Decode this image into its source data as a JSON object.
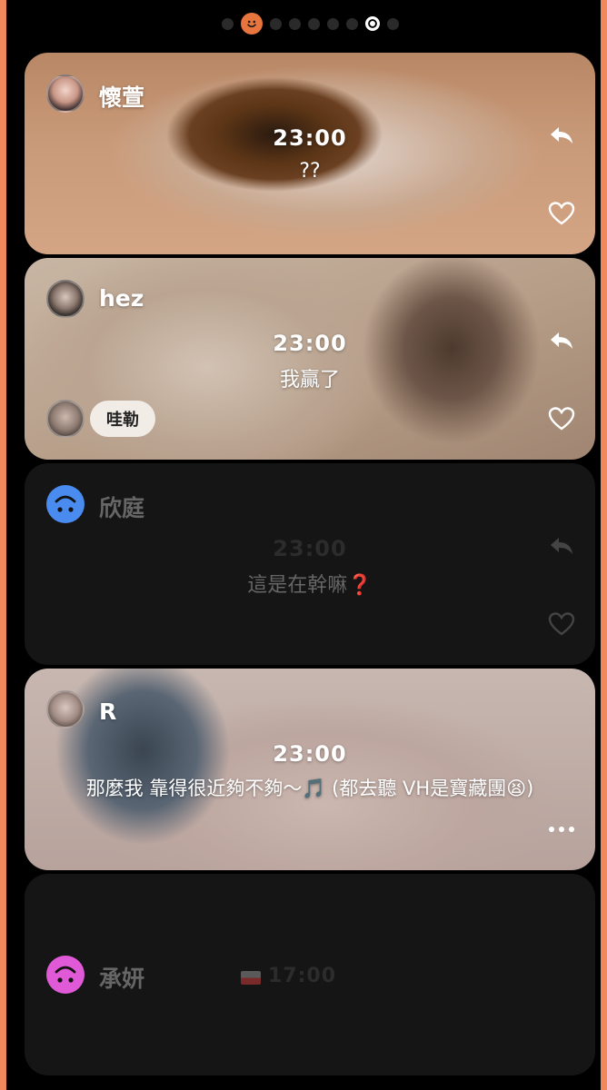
{
  "pagination": {
    "count": 9,
    "active_index": 7
  },
  "accent_color": "#f08a5d",
  "posts": [
    {
      "name": "懷萱",
      "time": "23:00",
      "message": "??"
    },
    {
      "name": "hez",
      "time": "23:00",
      "message": "我贏了",
      "reaction": {
        "label": "哇勒"
      }
    },
    {
      "name": "欣庭",
      "time": "23:00",
      "message": "這是在幹嘛❓"
    },
    {
      "name": "R",
      "time": "23:00",
      "message": "那麼我 靠得很近夠不夠～🎵 (都去聽 VH是寶藏團😫)"
    },
    {
      "name": "承妍",
      "time": "17:00"
    }
  ]
}
